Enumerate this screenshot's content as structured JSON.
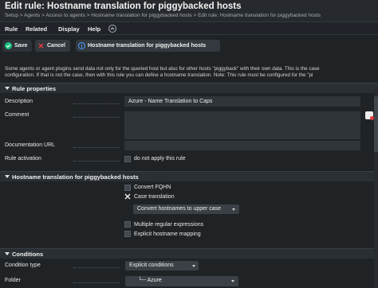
{
  "header": {
    "title": "Edit rule: Hostname translation for piggybacked hosts",
    "breadcrumb": "Setup > Agents > Access to agents > Hostname translation for piggybacked hosts > Edit rule: Hostname translation for piggybacked hosts"
  },
  "menubar": {
    "items": [
      "Rule",
      "Related",
      "Display",
      "Help"
    ]
  },
  "toolbar": {
    "save_label": "Save",
    "cancel_label": "Cancel",
    "info_label": "Hostname translation for piggybacked hosts"
  },
  "intro": {
    "line1": "Some agents or agent plugins send data not only for the queried host but also for other hosts \"piggyback\" with their own data. This is the case",
    "line2": "configuration. If that is not the case, then with this rule you can define a hostname translation. Note: This rule must be configured for the \"pi"
  },
  "sections": {
    "rule_properties": "Rule properties",
    "hostname_translation": "Hostname translation for piggybacked hosts",
    "conditions": "Conditions"
  },
  "rule_properties": {
    "description_label": "Description",
    "description_value": "Azure - Name Translation to Caps",
    "comment_label": "Comment",
    "comment_value": "",
    "doc_url_label": "Documentation URL",
    "doc_url_value": "",
    "activation_label": "Rule activation",
    "activation_checkbox_label": "do not apply this rule"
  },
  "translation": {
    "convert_fqhn": "Convert FQHN",
    "case_translation": "Case translation",
    "case_select_value": "Convert hostnames to upper case",
    "multiple_regex": "Multiple regular expressions",
    "explicit_mapping": "Explicit hostname mapping"
  },
  "conditions": {
    "type_label": "Condition type",
    "type_value": "Explicit conditions",
    "folder_label": "Folder",
    "folder_value": "└─ Azure"
  },
  "colors": {
    "background": "#1f2326",
    "save_icon": "#16c080",
    "info_icon": "#4aa0ff"
  }
}
